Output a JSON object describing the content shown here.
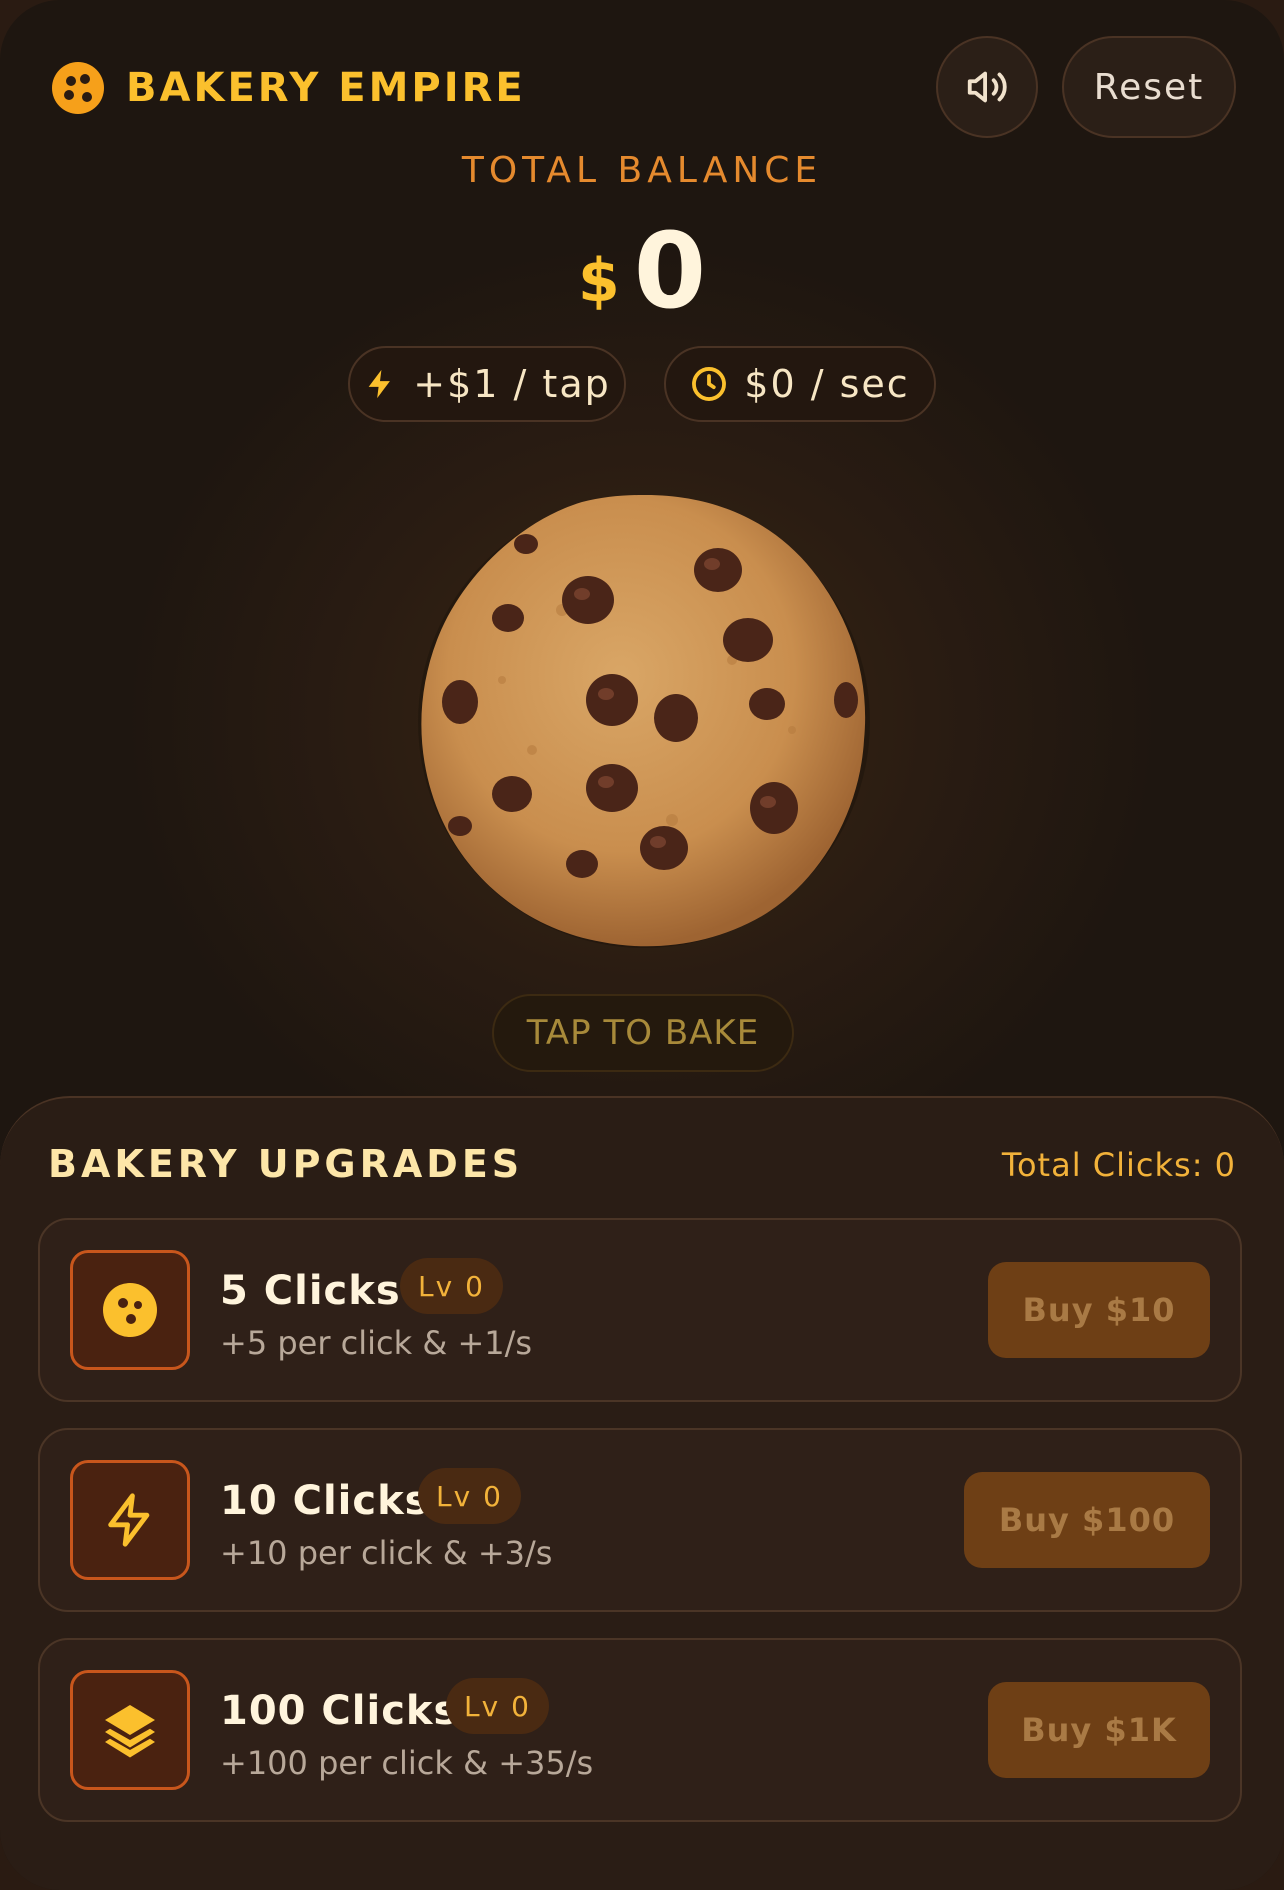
{
  "header": {
    "title": "BAKERY EMPIRE",
    "reset_label": "Reset"
  },
  "balance": {
    "label": "TOTAL BALANCE",
    "currency": "$",
    "amount": "0"
  },
  "stats": {
    "per_tap": "+$1 / tap",
    "per_sec": "$0 / sec"
  },
  "tap_label": "TAP TO BAKE",
  "upgrades": {
    "title": "BAKERY UPGRADES",
    "total_clicks": "Total Clicks: 0",
    "items": [
      {
        "name": "5 Clicks",
        "level": "Lv 0",
        "desc": "+5 per click & +1/s",
        "buy": "Buy $10",
        "icon": "cookie-icon"
      },
      {
        "name": "10 Clicks",
        "level": "Lv 0",
        "desc": "+10 per click & +3/s",
        "buy": "Buy $100",
        "icon": "lightning-icon"
      },
      {
        "name": "100 Clicks",
        "level": "Lv 0",
        "desc": "+100 per click & +35/s",
        "buy": "Buy $1K",
        "icon": "layers-icon"
      }
    ]
  },
  "colors": {
    "accent": "#fbc02d",
    "orange": "#e58a2e",
    "background": "#2a1b12",
    "buy_button": "#6e3f15"
  }
}
